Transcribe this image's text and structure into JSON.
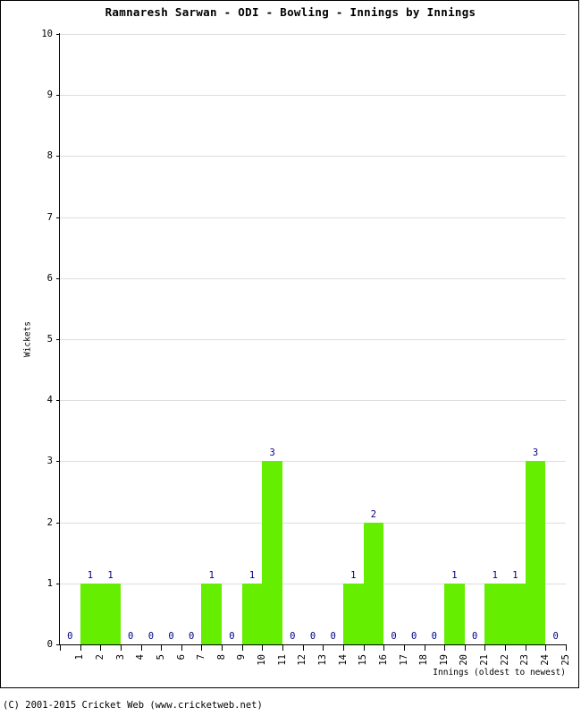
{
  "chart_data": {
    "type": "bar",
    "title": "Ramnaresh Sarwan - ODI - Bowling - Innings by Innings",
    "xlabel": "Innings (oldest to newest)",
    "ylabel": "Wickets",
    "categories": [
      "1",
      "2",
      "3",
      "4",
      "5",
      "6",
      "7",
      "8",
      "9",
      "10",
      "11",
      "12",
      "13",
      "14",
      "15",
      "16",
      "17",
      "18",
      "19",
      "20",
      "21",
      "22",
      "23",
      "24",
      "25"
    ],
    "values": [
      0,
      1,
      1,
      0,
      0,
      0,
      0,
      1,
      0,
      1,
      3,
      0,
      0,
      0,
      1,
      2,
      0,
      0,
      0,
      1,
      0,
      1,
      1,
      3,
      0
    ],
    "value_labels": [
      "0",
      "1",
      "1",
      "0",
      "0",
      "0",
      "0",
      "1",
      "0",
      "1",
      "3",
      "0",
      "0",
      "0",
      "1",
      "2",
      "0",
      "0",
      "0",
      "1",
      "0",
      "1",
      "1",
      "3",
      "0"
    ],
    "ylim": [
      0,
      10
    ],
    "ytick_labels": [
      "0",
      "1",
      "2",
      "3",
      "4",
      "5",
      "6",
      "7",
      "8",
      "9",
      "10"
    ],
    "ytick_values": [
      0,
      1,
      2,
      3,
      4,
      5,
      6,
      7,
      8,
      9,
      10
    ],
    "grid": true,
    "legend": null,
    "bar_color": "#66ee00",
    "value_label_color": "#000080",
    "grid_color": "#dddddd",
    "axis_color": "#000000"
  },
  "footer": {
    "copyright": "(C) 2001-2015 Cricket Web (www.cricketweb.net)"
  }
}
